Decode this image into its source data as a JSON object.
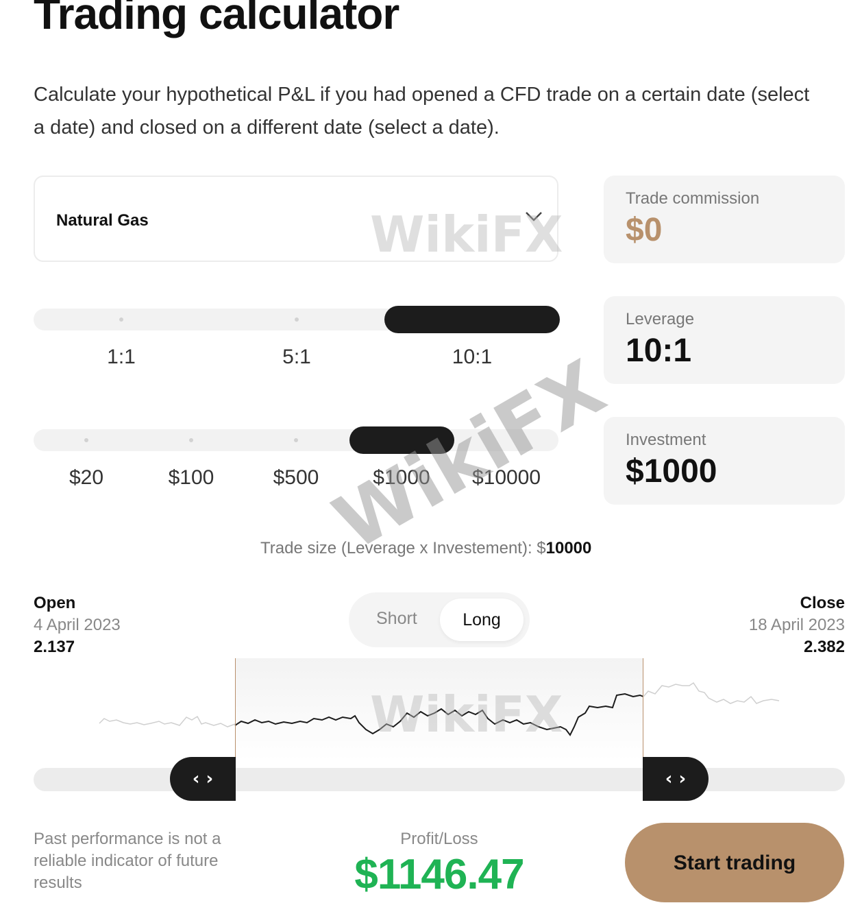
{
  "page": {
    "title": "Trading calculator",
    "subtitle": "Calculate your hypothetical P&L if you had opened a CFD trade on a certain date (select a date) and closed on a different date (select a date)."
  },
  "asset_select": {
    "value": "Natural Gas",
    "icon": "chevron-down-icon"
  },
  "leverage_slider": {
    "options": [
      "1:1",
      "5:1",
      "10:1"
    ],
    "selected_index": 2
  },
  "investment_slider": {
    "options": [
      "$20",
      "$100",
      "$500",
      "$1000",
      "$10000"
    ],
    "selected_index": 3
  },
  "cards": {
    "commission": {
      "label": "Trade commission",
      "value": "$0",
      "color": "#b8916c"
    },
    "leverage": {
      "label": "Leverage",
      "value": "10:1"
    },
    "investment": {
      "label": "Investment",
      "value": "$1000"
    }
  },
  "trade_size": {
    "label": "Trade size (Leverage x Investement): $",
    "value": "10000"
  },
  "open": {
    "label": "Open",
    "date": "4 April 2023",
    "price": "2.137"
  },
  "close": {
    "label": "Close",
    "date": "18 April 2023",
    "price": "2.382"
  },
  "direction_toggle": {
    "short_label": "Short",
    "long_label": "Long",
    "selected": "Long"
  },
  "range_handles": {
    "left_icon": "‹ ›",
    "right_icon": "‹ ›"
  },
  "footer": {
    "disclaimer": "Past performance is not a reliable indicator of future results",
    "pl_label": "Profit/Loss",
    "pl_value": "$1146.47",
    "pl_color": "#1fb354",
    "cta_label": "Start trading",
    "cta_color": "#b8916c"
  },
  "watermark": "WikiFX"
}
